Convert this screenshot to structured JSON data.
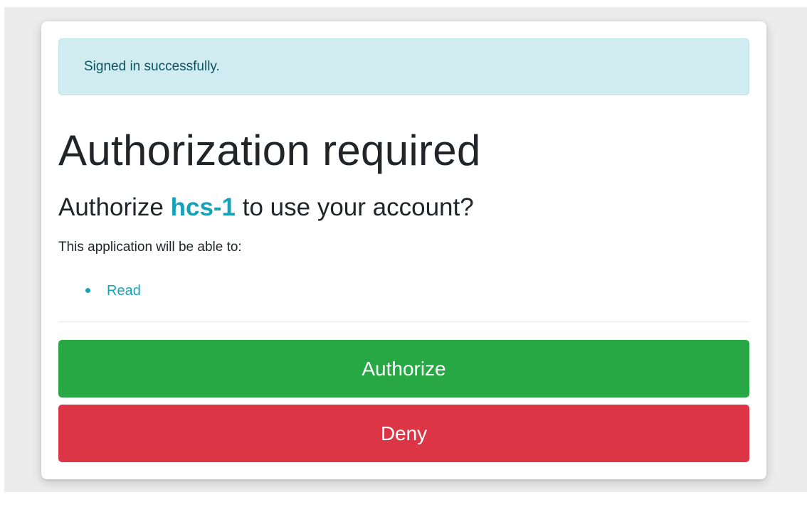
{
  "alert": {
    "message": "Signed in successfully."
  },
  "page": {
    "title": "Authorization required",
    "subtitle_prefix": "Authorize ",
    "app_name": "hcs-1",
    "subtitle_suffix": " to use your account?",
    "description": "This application will be able to:"
  },
  "scopes": [
    {
      "label": "Read"
    }
  ],
  "actions": {
    "authorize_label": "Authorize",
    "deny_label": "Deny"
  },
  "colors": {
    "alert_bg": "#d1ecf1",
    "app_name": "#17a2b8",
    "authorize": "#28a745",
    "deny": "#dc3545"
  }
}
